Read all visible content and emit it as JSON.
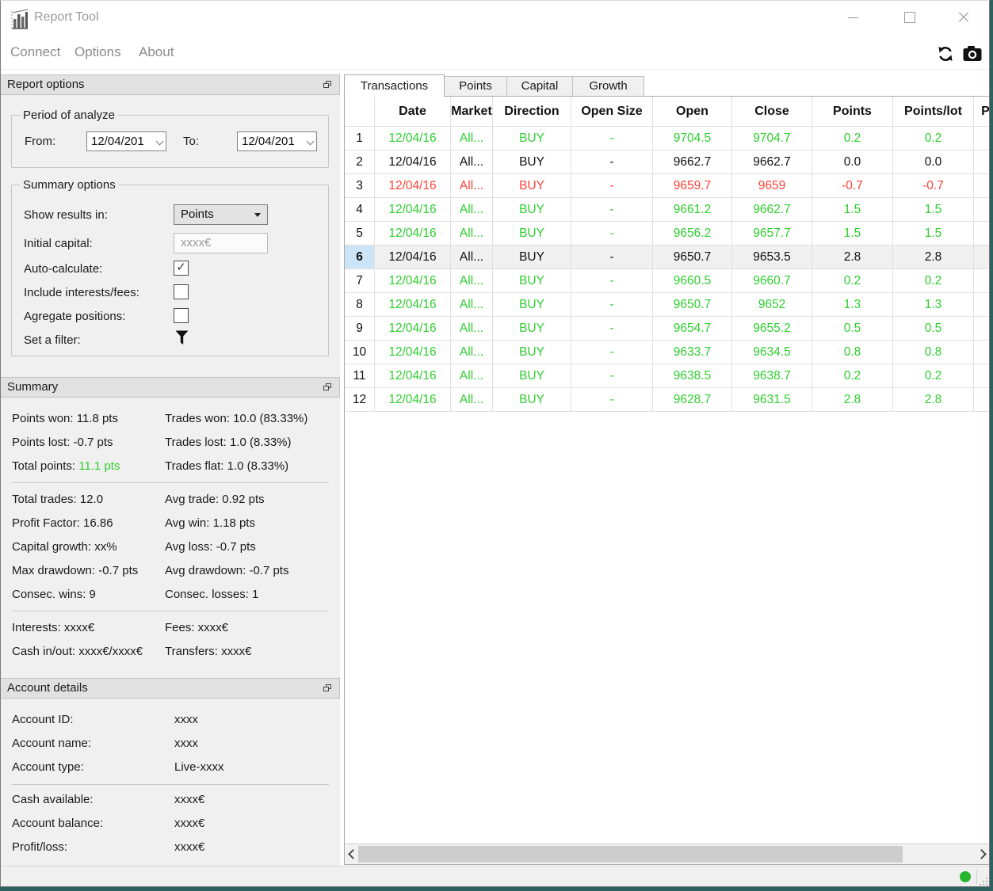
{
  "colors": {
    "positive": "#2fce2f",
    "negative": "#ff4136",
    "selrow": "#cbe4f6",
    "statusgreen": "#27b52d"
  },
  "titlebar": {
    "title": "Report Tool"
  },
  "menu": {
    "items": [
      "Connect",
      "Options",
      "About"
    ]
  },
  "report_options": {
    "title": "Report options",
    "period": {
      "label": "Period of analyze",
      "from_label": "From:",
      "from_value": "12/04/201",
      "to_label": "To:",
      "to_value": "12/04/201"
    },
    "options": {
      "label": "Summary options",
      "show_results_label": "Show results in:",
      "show_results_value": "Points",
      "initial_capital_label": "Initial capital:",
      "initial_capital_value": "xxxx€",
      "auto_calculate_label": "Auto-calculate:",
      "auto_calculate_checked": true,
      "include_fees_label": "Include interests/fees:",
      "include_fees_checked": false,
      "aggregate_label": "Agregate positions:",
      "aggregate_checked": false,
      "filter_label": "Set a filter:"
    }
  },
  "summary": {
    "title": "Summary",
    "blocks": [
      {
        "rows": [
          {
            "left": "Points won: 11.8 pts",
            "right": "Trades won: 10.0 (83.33%)"
          },
          {
            "left": "Points lost: -0.7 pts",
            "right": "Trades lost: 1.0 (8.33%)"
          },
          {
            "left": "Total points: ",
            "left_highlight": "11.1 pts",
            "right": "Trades flat: 1.0 (8.33%)"
          }
        ]
      },
      {
        "rows": [
          {
            "left": "Total trades: 12.0",
            "right": "Avg trade: 0.92 pts"
          },
          {
            "left": "Profit Factor: 16.86",
            "right": "Avg win: 1.18 pts"
          },
          {
            "left": "Capital growth: xx%",
            "right": "Avg loss: -0.7 pts"
          },
          {
            "left": "Max drawdown: -0.7 pts",
            "right": "Avg drawdown: -0.7 pts"
          },
          {
            "left": "Consec. wins: 9",
            "right": "Consec. losses: 1"
          }
        ]
      },
      {
        "rows": [
          {
            "left": "Interests: xxxx€",
            "right": "Fees: xxxx€"
          },
          {
            "left": "Cash in/out: xxxx€/xxxx€",
            "right": "Transfers: xxxx€"
          }
        ]
      }
    ]
  },
  "account": {
    "title": "Account details",
    "groups": [
      {
        "rows": [
          {
            "label": "Account ID:",
            "value": "xxxx"
          },
          {
            "label": "Account name:",
            "value": "xxxx"
          },
          {
            "label": "Account type:",
            "value": "Live-xxxx"
          }
        ]
      },
      {
        "rows": [
          {
            "label": "Cash available:",
            "value": "xxxx€"
          },
          {
            "label": "Account balance:",
            "value": "xxxx€"
          },
          {
            "label": "Profit/loss:",
            "value": "xxxx€"
          }
        ]
      }
    ]
  },
  "tabs": {
    "items": [
      "Transactions",
      "Points",
      "Capital",
      "Growth"
    ],
    "active": "Transactions"
  },
  "table": {
    "headers": [
      "",
      "Date",
      "Market",
      "Direction",
      "Open Size",
      "Open",
      "Close",
      "Points",
      "Points/lot",
      "Profit"
    ],
    "rows": [
      {
        "num": "1",
        "date": "12/04/16",
        "market": "All...",
        "direction": "BUY",
        "open_size": "-",
        "open": "9704.5",
        "close": "9704.7",
        "points": "0.2",
        "points_lot": "0.2",
        "tone": "pos",
        "selected": false
      },
      {
        "num": "2",
        "date": "12/04/16",
        "market": "All...",
        "direction": "BUY",
        "open_size": "-",
        "open": "9662.7",
        "close": "9662.7",
        "points": "0.0",
        "points_lot": "0.0",
        "tone": "flat",
        "selected": false
      },
      {
        "num": "3",
        "date": "12/04/16",
        "market": "All...",
        "direction": "BUY",
        "open_size": "-",
        "open": "9659.7",
        "close": "9659",
        "points": "-0.7",
        "points_lot": "-0.7",
        "tone": "neg",
        "selected": false
      },
      {
        "num": "4",
        "date": "12/04/16",
        "market": "All...",
        "direction": "BUY",
        "open_size": "-",
        "open": "9661.2",
        "close": "9662.7",
        "points": "1.5",
        "points_lot": "1.5",
        "tone": "pos",
        "selected": false
      },
      {
        "num": "5",
        "date": "12/04/16",
        "market": "All...",
        "direction": "BUY",
        "open_size": "-",
        "open": "9656.2",
        "close": "9657.7",
        "points": "1.5",
        "points_lot": "1.5",
        "tone": "pos",
        "selected": false
      },
      {
        "num": "6",
        "date": "12/04/16",
        "market": "All...",
        "direction": "BUY",
        "open_size": "-",
        "open": "9650.7",
        "close": "9653.5",
        "points": "2.8",
        "points_lot": "2.8",
        "tone": "flat",
        "selected": true
      },
      {
        "num": "7",
        "date": "12/04/16",
        "market": "All...",
        "direction": "BUY",
        "open_size": "-",
        "open": "9660.5",
        "close": "9660.7",
        "points": "0.2",
        "points_lot": "0.2",
        "tone": "pos",
        "selected": false
      },
      {
        "num": "8",
        "date": "12/04/16",
        "market": "All...",
        "direction": "BUY",
        "open_size": "-",
        "open": "9650.7",
        "close": "9652",
        "points": "1.3",
        "points_lot": "1.3",
        "tone": "pos",
        "selected": false
      },
      {
        "num": "9",
        "date": "12/04/16",
        "market": "All...",
        "direction": "BUY",
        "open_size": "-",
        "open": "9654.7",
        "close": "9655.2",
        "points": "0.5",
        "points_lot": "0.5",
        "tone": "pos",
        "selected": false
      },
      {
        "num": "10",
        "date": "12/04/16",
        "market": "All...",
        "direction": "BUY",
        "open_size": "-",
        "open": "9633.7",
        "close": "9634.5",
        "points": "0.8",
        "points_lot": "0.8",
        "tone": "pos",
        "selected": false
      },
      {
        "num": "11",
        "date": "12/04/16",
        "market": "All...",
        "direction": "BUY",
        "open_size": "-",
        "open": "9638.5",
        "close": "9638.7",
        "points": "0.2",
        "points_lot": "0.2",
        "tone": "pos",
        "selected": false
      },
      {
        "num": "12",
        "date": "12/04/16",
        "market": "All...",
        "direction": "BUY",
        "open_size": "-",
        "open": "9628.7",
        "close": "9631.5",
        "points": "2.8",
        "points_lot": "2.8",
        "tone": "pos",
        "selected": false
      }
    ]
  }
}
